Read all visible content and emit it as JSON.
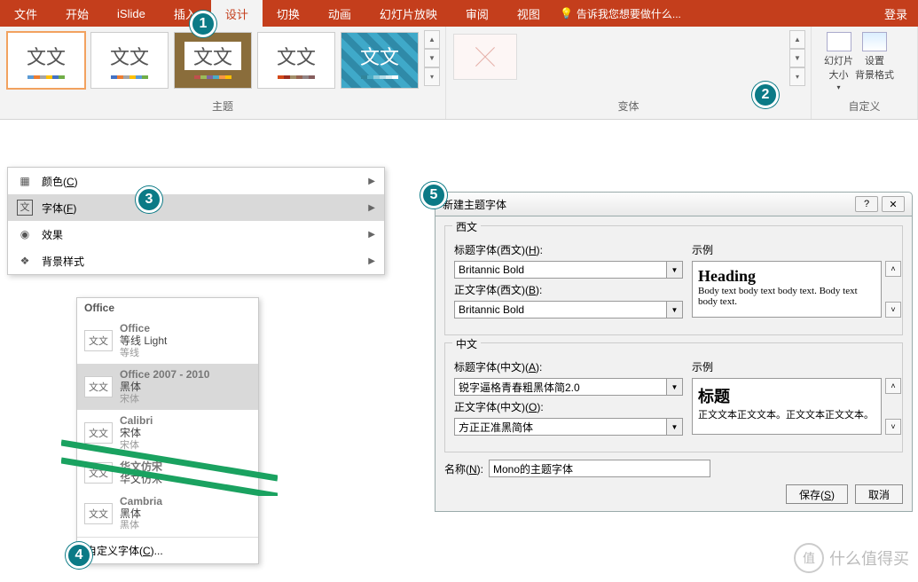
{
  "ribbon": {
    "tabs": [
      "文件",
      "开始",
      "iSlide",
      "插入",
      "设计",
      "切换",
      "动画",
      "幻灯片放映",
      "审阅",
      "视图"
    ],
    "active_tab": "设计",
    "tell_me": "告诉我您想要做什么...",
    "login": "登录",
    "groups": {
      "themes": "主题",
      "variants": "变体",
      "custom": "自定义"
    },
    "custom_buttons": {
      "slide_size": "幻灯片\n大小",
      "format_bg": "设置\n背景格式"
    },
    "theme_glyph": "文文"
  },
  "context_menu": {
    "items": [
      {
        "label": "颜色(",
        "accel": "C",
        "suffix": ")",
        "icon": "palette-icon"
      },
      {
        "label": "字体(",
        "accel": "F",
        "suffix": ")",
        "icon": "font-icon",
        "selected": true
      },
      {
        "label": "效果",
        "icon": "effects-icon"
      },
      {
        "label": "背景样式",
        "icon": "background-icon"
      }
    ]
  },
  "font_list": {
    "header": "Office",
    "items": [
      {
        "name": "Office",
        "sub": "等线 Light",
        "minor": "等线"
      },
      {
        "name": "Office 2007 - 2010",
        "sub": "黑体",
        "minor": "宋体",
        "selected": true
      },
      {
        "name": "Calibri",
        "sub": "宋体",
        "minor": "宋体"
      },
      {
        "name": "华文仿宋",
        "sub": "华文仿宋",
        "minor": ""
      },
      {
        "name": "Cambria",
        "sub": "黑体",
        "minor": "黑体"
      }
    ],
    "custom": "自定义字体(",
    "custom_accel": "C",
    "custom_suffix": "...",
    "thumb_glyph": "文文"
  },
  "dialog": {
    "title": "新建主题字体",
    "group_latin": "西文",
    "group_cjk": "中文",
    "sample_label": "示例",
    "latin_heading_label": "标题字体(西文)(",
    "latin_heading_accel": "H",
    "latin_heading_suffix": "):",
    "latin_body_label": "正文字体(西文)(",
    "latin_body_accel": "B",
    "latin_body_suffix": "):",
    "latin_heading_value": "Britannic Bold",
    "latin_body_value": "Britannic Bold",
    "cjk_heading_label": "标题字体(中文)(",
    "cjk_heading_accel": "A",
    "cjk_heading_suffix": "):",
    "cjk_body_label": "正文字体(中文)(",
    "cjk_body_accel": "O",
    "cjk_body_suffix": "):",
    "cjk_heading_value": "锐字逼格青春粗黑体简2.0",
    "cjk_body_value": "方正正准黑简体",
    "preview_latin_heading": "Heading",
    "preview_latin_body": "Body text body text body text. Body text body text.",
    "preview_cjk_heading": "标题",
    "preview_cjk_body": "正文文本正文文本。正文文本正文文本。",
    "name_label": "名称(",
    "name_accel": "N",
    "name_suffix": "):",
    "name_value": "Mono的主题字体",
    "save": "保存(",
    "save_accel": "S",
    "save_suffix": ")",
    "cancel": "取消",
    "help": "?",
    "close": "✕"
  },
  "badges": {
    "b1": "1",
    "b2": "2",
    "b3": "3",
    "b4": "4",
    "b5": "5"
  },
  "watermark": {
    "glyph": "值",
    "text": "什么值得买"
  }
}
